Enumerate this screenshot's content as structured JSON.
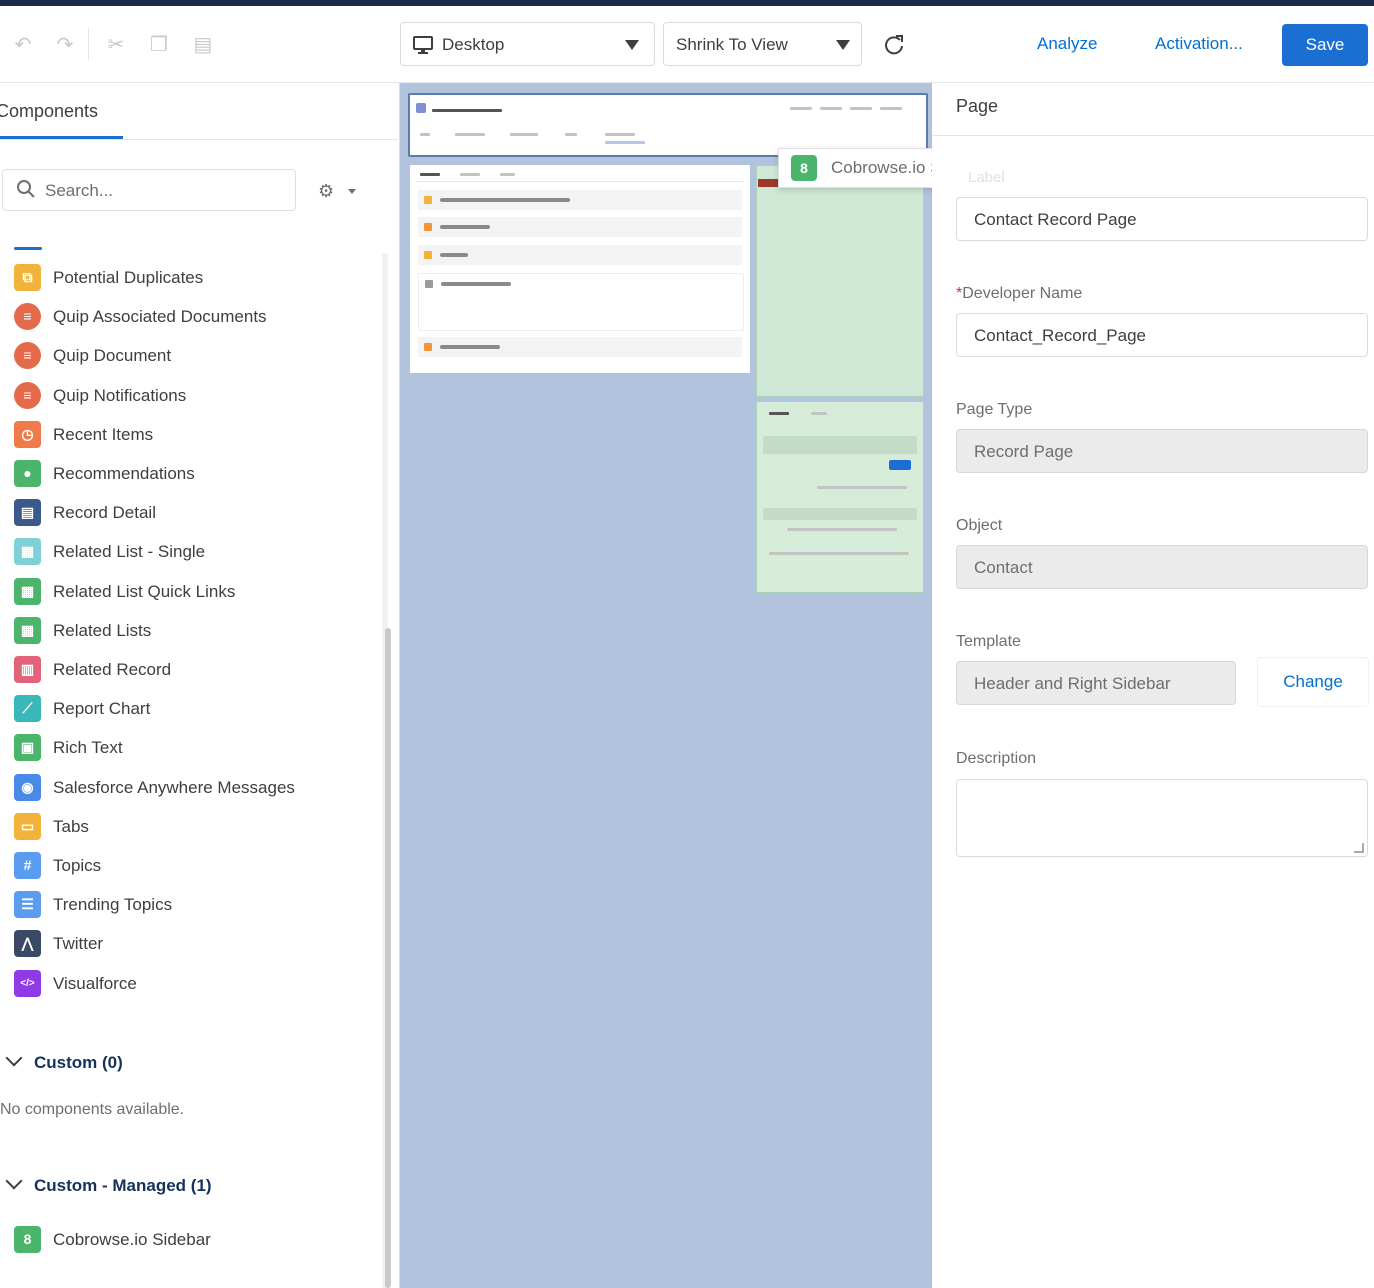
{
  "toolbar": {
    "undo_icon": "undo-icon",
    "redo_icon": "redo-icon",
    "cut_icon": "cut-icon",
    "copy_icon": "copy-icon",
    "paste_icon": "paste-icon",
    "device_select": "Desktop",
    "view_select": "Shrink To View",
    "refresh_icon": "refresh-icon",
    "analyze": "Analyze",
    "activation": "Activation...",
    "save": "Save"
  },
  "left_panel": {
    "tab": "Components",
    "search_placeholder": "Search...",
    "components": [
      {
        "label": "Potential Duplicates",
        "icon": "duplicate-icon",
        "color": "#f2b33a"
      },
      {
        "label": "Quip Associated Documents",
        "icon": "quip-icon",
        "color": "#e36a4a"
      },
      {
        "label": "Quip Document",
        "icon": "quip-icon",
        "color": "#e36a4a"
      },
      {
        "label": "Quip Notifications",
        "icon": "quip-icon",
        "color": "#e36a4a"
      },
      {
        "label": "Recent Items",
        "icon": "clock-icon",
        "color": "#f07a4a"
      },
      {
        "label": "Recommendations",
        "icon": "lightbulb-icon",
        "color": "#4bb66b"
      },
      {
        "label": "Record Detail",
        "icon": "record-detail-icon",
        "color": "#3a5a8c"
      },
      {
        "label": "Related List - Single",
        "icon": "list-icon",
        "color": "#7fd1d8"
      },
      {
        "label": "Related List Quick Links",
        "icon": "list-icon",
        "color": "#4bb66b"
      },
      {
        "label": "Related Lists",
        "icon": "list-icon",
        "color": "#4bb66b"
      },
      {
        "label": "Related Record",
        "icon": "record-icon",
        "color": "#e2637a"
      },
      {
        "label": "Report Chart",
        "icon": "chart-icon",
        "color": "#3ab7b8"
      },
      {
        "label": "Rich Text",
        "icon": "rich-text-icon",
        "color": "#4bb66b"
      },
      {
        "label": "Salesforce Anywhere Messages",
        "icon": "chat-icon",
        "color": "#4a8ae6"
      },
      {
        "label": "Tabs",
        "icon": "tabs-icon",
        "color": "#f2b33a"
      },
      {
        "label": "Topics",
        "icon": "hash-icon",
        "color": "#5a9cf0"
      },
      {
        "label": "Trending Topics",
        "icon": "trending-icon",
        "color": "#5a9cf0"
      },
      {
        "label": "Twitter",
        "icon": "twitter-icon",
        "color": "#3a4a66"
      },
      {
        "label": "Visualforce",
        "icon": "code-icon",
        "color": "#8e3ae6"
      }
    ],
    "custom_header": "Custom (0)",
    "custom_empty": "No components available.",
    "managed_header": "Custom - Managed (1)",
    "managed_components": [
      {
        "label": "Cobrowse.io Sidebar",
        "icon": "cobrowse-icon",
        "color": "#4bb66b"
      }
    ]
  },
  "drag_tooltip": {
    "label": "Cobrowse.io Sidebar",
    "icon": "cobrowse-icon"
  },
  "right_panel": {
    "title": "Page",
    "label_ghost": "Label",
    "label_value": "Contact Record Page",
    "developer_name_label": "Developer Name",
    "developer_name_value": "Contact_Record_Page",
    "page_type_label": "Page Type",
    "page_type_value": "Record Page",
    "object_label": "Object",
    "object_value": "Contact",
    "template_label": "Template",
    "template_value": "Header and Right Sidebar",
    "change_button": "Change",
    "description_label": "Description"
  },
  "colors": {
    "brand": "#1b6fd2",
    "canvas_bg": "#b2c3de",
    "sidebar_highlight": "#cfe8d6"
  }
}
